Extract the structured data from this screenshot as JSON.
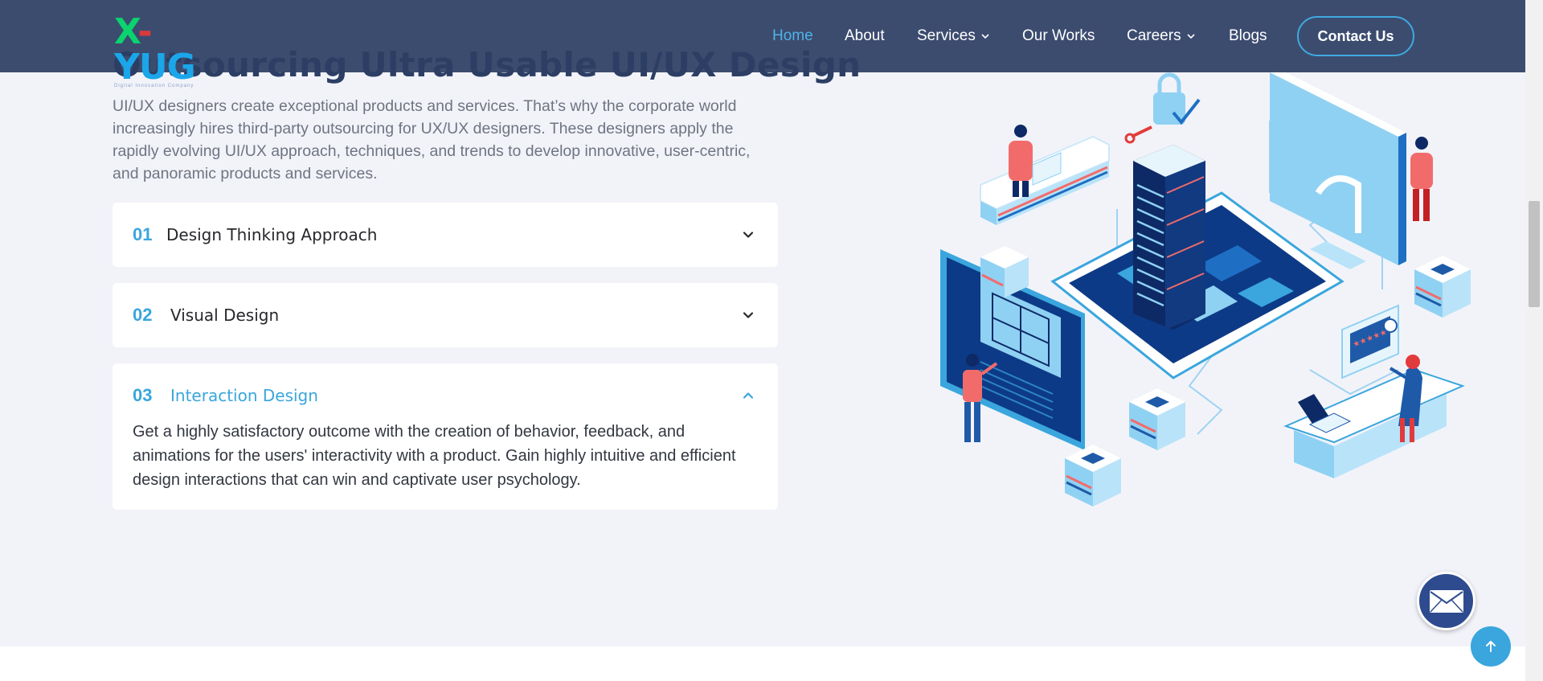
{
  "brand": {
    "logo_text_x": "X",
    "logo_text_dash": "-",
    "logo_text_rest": "YUG",
    "logo_tagline": "Digital Innovation Company"
  },
  "nav": {
    "items": [
      {
        "label": "Home",
        "active": true
      },
      {
        "label": "About"
      },
      {
        "label": "Services",
        "dropdown": true
      },
      {
        "label": "Our Works"
      },
      {
        "label": "Careers",
        "dropdown": true
      },
      {
        "label": "Blogs"
      }
    ],
    "cta": "Contact Us"
  },
  "section": {
    "title": "Outsourcing Ultra Usable UI/UX Design",
    "intro": "UI/UX designers create exceptional products and services. That’s why the corporate world increasingly hires third-party outsourcing for UX/UX designers. These designers apply the rapidly evolving UI/UX approach, techniques, and trends to develop innovative, user-centric, and panoramic products and services."
  },
  "accordion": [
    {
      "number": "01",
      "title": "Design Thinking Approach",
      "open": false
    },
    {
      "number": "02",
      "title": "Visual Design",
      "open": false
    },
    {
      "number": "03",
      "title": "Interaction Design",
      "open": true,
      "body": "Get a highly satisfactory outcome with the creation of behavior, feedback, and animations for the users' interactivity with a product. Gain highly intuitive and efficient design interactions that can win and captivate user psychology."
    }
  ],
  "illustration": {
    "stars_text": "★★★★★"
  },
  "floating": {
    "mail_icon": "envelope-icon",
    "top_icon": "arrow-up-icon"
  },
  "colors": {
    "header_bg": "#2d3e63",
    "accent": "#3aa6dd",
    "title": "#2c3e64",
    "page_bg": "#f2f3f9"
  }
}
